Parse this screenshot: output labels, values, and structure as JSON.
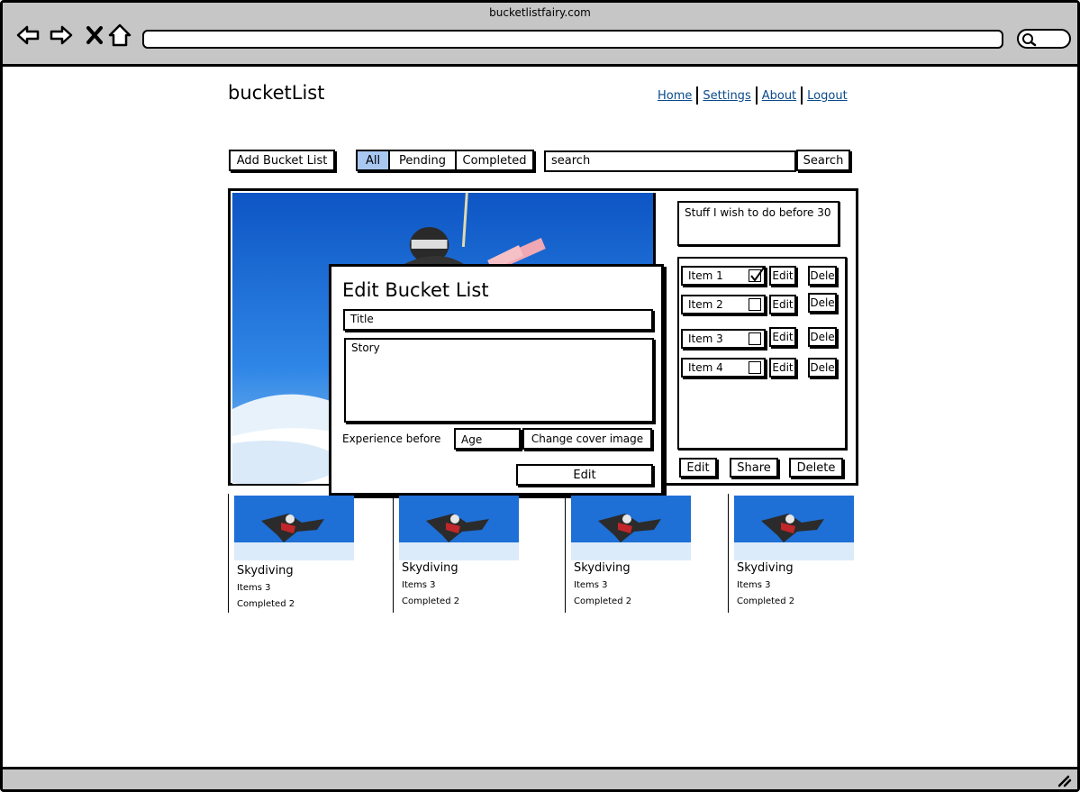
{
  "browser": {
    "site_title": "bucketlistfairy.com"
  },
  "header": {
    "logo": "bucketList",
    "nav": [
      "Home",
      "Settings",
      "About",
      "Logout"
    ]
  },
  "toolbar": {
    "add_label": "Add Bucket List",
    "filters": [
      "All",
      "Pending",
      "Completed"
    ],
    "active_filter": "All",
    "search_placeholder": "search",
    "search_button": "Search"
  },
  "detail": {
    "description": "Stuff I wish to do before 30",
    "items": [
      {
        "label": "Item 1",
        "checked": true
      },
      {
        "label": "Item 2",
        "checked": false
      },
      {
        "label": "Item 3",
        "checked": false
      },
      {
        "label": "Item 4",
        "checked": false
      }
    ],
    "item_edit_label": "Edit",
    "item_delete_label": "Dele",
    "edit_label": "Edit",
    "share_label": "Share",
    "delete_label": "Delete"
  },
  "modal": {
    "title": "Edit Bucket List",
    "title_placeholder": "Title",
    "story_placeholder": "Story",
    "experience_label": "Experience before",
    "age_placeholder": "Age",
    "change_cover_label": "Change cover image",
    "submit_label": "Edit"
  },
  "cards": [
    {
      "title": "Skydiving",
      "items": "Items 3",
      "completed": "Completed 2"
    },
    {
      "title": "Skydiving",
      "items": "Items 3",
      "completed": "Completed 2"
    },
    {
      "title": "Skydiving",
      "items": "Items 3",
      "completed": "Completed 2"
    },
    {
      "title": "Skydiving",
      "items": "Items 3",
      "completed": "Completed 2"
    }
  ],
  "colors": {
    "chrome": "#c6c6c6",
    "active_filter": "#a8c8f2",
    "link": "#0a4a8a",
    "sky": "#1e6fd6"
  },
  "icons": {
    "back": "back-arrow-icon",
    "forward": "forward-arrow-icon",
    "stop": "close-icon",
    "home": "home-icon",
    "search": "search-icon",
    "resize": "resize-grip-icon",
    "check": "check-icon"
  }
}
